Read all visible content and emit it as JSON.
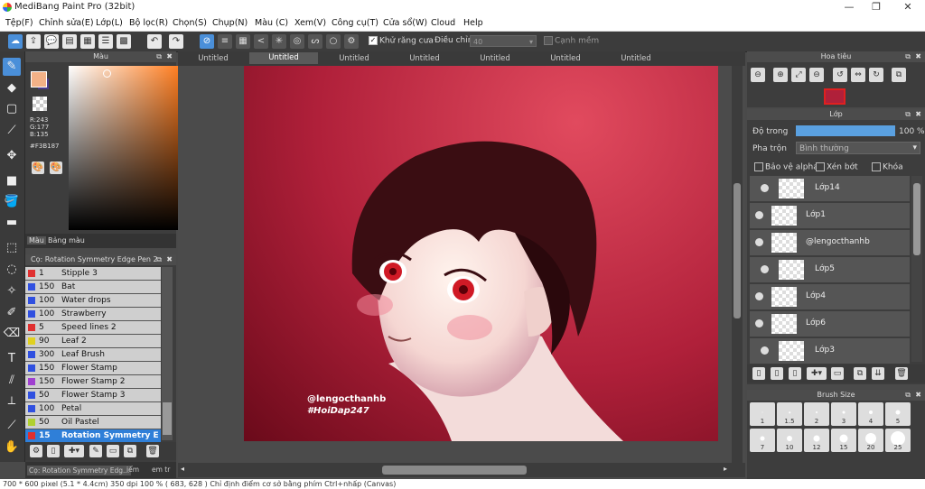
{
  "window": {
    "title": "MediBang Paint Pro (32bit)",
    "controls": [
      "—",
      "❐",
      "✕"
    ]
  },
  "menu": [
    "Tệp(F)",
    "Chỉnh sửa(E)",
    "Lớp(L)",
    "Bộ lọc(R)",
    "Chọn(S)",
    "Chụp(N)",
    "Màu (C)",
    "Xem(V)",
    "Công cụ(T)",
    "Cửa sổ(W)",
    "Cloud",
    "Help"
  ],
  "toolbar": {
    "antialias_label": "Khử răng cưa",
    "antialias_checked": true,
    "adjust_label": "Điều chỉnh",
    "adjust_value": "40",
    "edge_label": "Cạnh mềm",
    "edge_checked": false
  },
  "color_panel": {
    "title": "Màu",
    "rgb": {
      "r": "R:243",
      "g": "G:177",
      "b": "B:135"
    },
    "hex": "#F3B187",
    "primary_color": "#F3B187",
    "secondary_color": "#4a3a8a",
    "tabs": [
      "Màu",
      "Bảng màu"
    ]
  },
  "brush_panel": {
    "title": "Cọ: Rotation Symmetry Edge Pen 2",
    "items": [
      {
        "size": "1",
        "name": "Stipple 3",
        "color": "#e03030"
      },
      {
        "size": "150",
        "name": "Bat",
        "color": "#3050e0"
      },
      {
        "size": "100",
        "name": "Water drops",
        "color": "#3050e0"
      },
      {
        "size": "100",
        "name": "Strawberry",
        "color": "#3050e0"
      },
      {
        "size": "5",
        "name": "Speed lines 2",
        "color": "#e03030"
      },
      {
        "size": "90",
        "name": "Leaf 2",
        "color": "#e0d020"
      },
      {
        "size": "300",
        "name": "Leaf Brush",
        "color": "#3050e0"
      },
      {
        "size": "150",
        "name": "Flower Stamp",
        "color": "#3050e0"
      },
      {
        "size": "150",
        "name": "Flower Stamp 2",
        "color": "#a040d0"
      },
      {
        "size": "50",
        "name": "Flower Stamp 3",
        "color": "#3050e0"
      },
      {
        "size": "100",
        "name": "Petal",
        "color": "#3050e0"
      },
      {
        "size": "50",
        "name": "Oil Pastel",
        "color": "#b0d030"
      },
      {
        "size": "15",
        "name": "Rotation Symmetry Edge",
        "color": "#e03030",
        "selected": true
      }
    ],
    "bottom_tabs": [
      "Cọ: Rotation Symmetry Edg...",
      "iểm",
      "em tr"
    ]
  },
  "doc_tabs": [
    {
      "label": "Untitled"
    },
    {
      "label": "Untitled",
      "active": true
    },
    {
      "label": "Untitled"
    },
    {
      "label": "Untitled"
    },
    {
      "label": "Untitled"
    },
    {
      "label": "Untitled"
    },
    {
      "label": "Untitled"
    }
  ],
  "artwork": {
    "watermark_line1": "@lengocthanhb",
    "watermark_line2": "#HoiDap247"
  },
  "navigator": {
    "title": "Hoa tiêu"
  },
  "layer_panel": {
    "title": "Lớp",
    "opacity_label": "Độ trong",
    "opacity_value": "100 %",
    "opacity_level": 1.0,
    "blend_label": "Pha trộn",
    "blend_value": "Bình thường",
    "protect_alpha": "Bảo vệ alpha",
    "clipping": "Xén bớt",
    "lock": "Khóa",
    "layers": [
      {
        "name": "Lớp14",
        "indent": true
      },
      {
        "name": "Lớp1",
        "indent": false
      },
      {
        "name": "@lengocthanhb",
        "indent": false
      },
      {
        "name": "Lớp5",
        "indent": true
      },
      {
        "name": "Lớp4",
        "indent": false
      },
      {
        "name": "Lớp6",
        "indent": false
      },
      {
        "name": "Lớp3",
        "indent": true
      }
    ]
  },
  "brush_size": {
    "title": "Brush Size",
    "row1": [
      "1",
      "1.5",
      "2",
      "3",
      "4",
      "5"
    ],
    "row2": [
      "7",
      "10",
      "12",
      "15",
      "20",
      "25"
    ]
  },
  "status": "700 * 600 pixel   (5.1 * 4.4cm)   350 dpi   100 %   ( 683, 628 )   Chỉ định điểm cơ sở bằng phím Ctrl+nhấp (Canvas)"
}
